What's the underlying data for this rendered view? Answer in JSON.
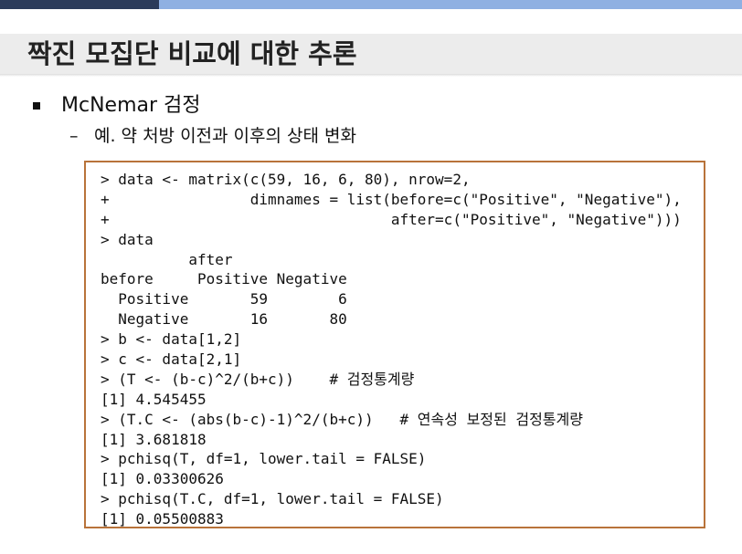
{
  "slide": {
    "title": "짝진 모집단 비교에 대한 추론",
    "bullet_level1": "McNemar 검정",
    "bullet_level2_marker": "–",
    "bullet_level2": "예.  약 처방 이전과 이후의 상태 변화"
  },
  "code": {
    "lines": [
      "> data <- matrix(c(59, 16, 6, 80), nrow=2,",
      "+                dimnames = list(before=c(\"Positive\", \"Negative\"),",
      "+                                after=c(\"Positive\", \"Negative\")))",
      "> data",
      "          after",
      "before     Positive Negative",
      "  Positive       59        6",
      "  Negative       16       80",
      "> b <- data[1,2]",
      "> c <- data[2,1]",
      "> (T <- (b-c)^2/(b+c))    # 검정통계량",
      "[1] 4.545455",
      "> (T.C <- (abs(b-c)-1)^2/(b+c))   # 연속성 보정된 검정통계량",
      "[1] 3.681818",
      "> pchisq(T, df=1, lower.tail = FALSE)",
      "[1] 0.03300626",
      "> pchisq(T.C, df=1, lower.tail = FALSE)",
      "[1] 0.05500883"
    ]
  },
  "colors": {
    "top_bar_dark": "#2b3b5a",
    "top_bar_light": "#8fb0e2",
    "title_band": "#ececec",
    "code_border": "#b8733a"
  }
}
